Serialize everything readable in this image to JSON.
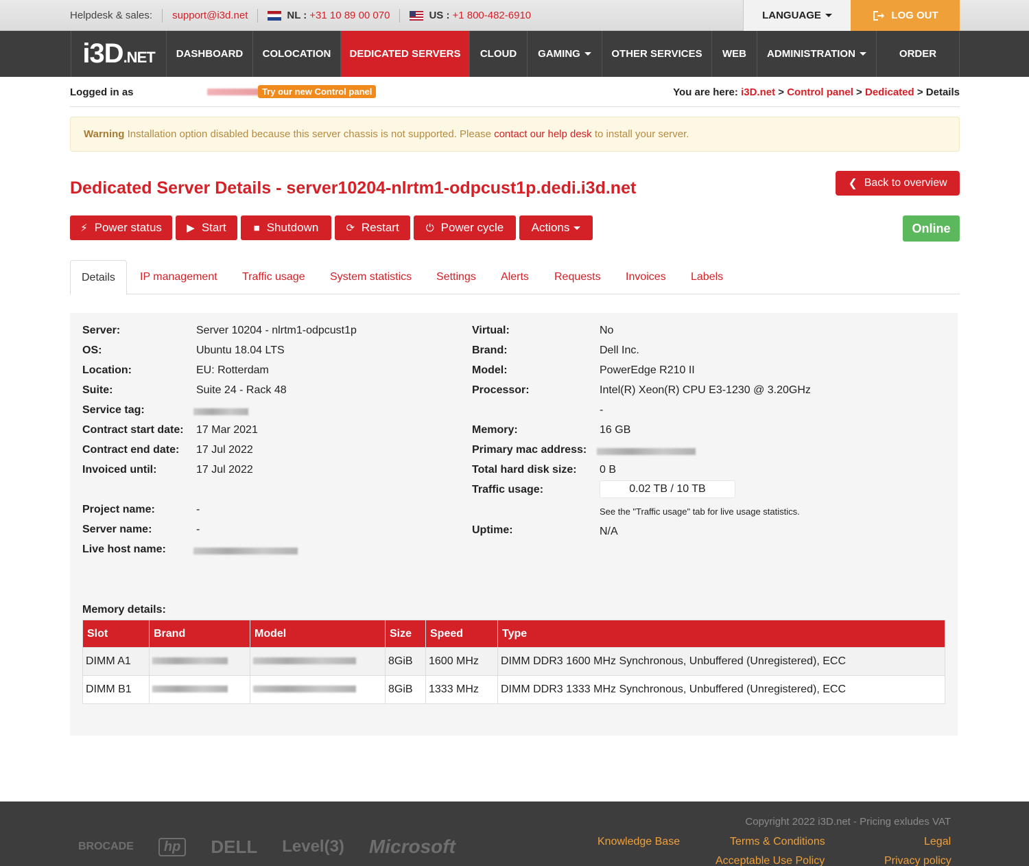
{
  "topbar": {
    "helpdesk_label": "Helpdesk & sales:",
    "email": "support@i3d.net",
    "nl_label": "NL :",
    "nl_phone": "+31 10 89 00 070",
    "us_label": "US :",
    "us_phone": "+1 800-482-6910",
    "language": "LANGUAGE",
    "logout": "LOG OUT"
  },
  "nav": {
    "logo_main": "i3D",
    "logo_suffix": ".NET",
    "items": [
      "DASHBOARD",
      "COLOCATION",
      "DEDICATED SERVERS",
      "CLOUD",
      "GAMING",
      "OTHER SERVICES",
      "WEB",
      "ADMINISTRATION",
      "ORDER"
    ]
  },
  "subheader": {
    "logged_in": "Logged in as",
    "try_new": "Try our new Control panel",
    "you_are_here": "You are here:",
    "crumb_1": "i3D.net",
    "crumb_2": "Control panel",
    "crumb_3": "Dedicated",
    "crumb_4": "Details"
  },
  "warning": {
    "title": "Warning",
    "text_1": "Installation option disabled because this server chassis is not supported. Please",
    "link": "contact our help desk",
    "text_2": "to install your server."
  },
  "page_title": "Dedicated Server Details - server10204-nlrtm1-odpcust1p.dedi.i3d.net",
  "back_button": "Back to overview",
  "actions": [
    "Power status",
    "Start",
    "Shutdown",
    "Restart",
    "Power cycle",
    "Actions"
  ],
  "status_badge": "Online",
  "tabs": [
    "Details",
    "IP management",
    "Traffic usage",
    "System statistics",
    "Settings",
    "Alerts",
    "Requests",
    "Invoices",
    "Labels"
  ],
  "details_left": [
    {
      "label": "Server:",
      "value": "Server 10204 - nlrtm1-odpcust1p"
    },
    {
      "label": "OS:",
      "value": "Ubuntu 18.04 LTS"
    },
    {
      "label": "Location:",
      "value": "EU: Rotterdam"
    },
    {
      "label": "Suite:",
      "value": "Suite 24 - Rack 48"
    },
    {
      "label": "Service tag:",
      "value": ""
    },
    {
      "label": "Contract start date:",
      "value": "17 Mar 2021"
    },
    {
      "label": "Contract end date:",
      "value": "17 Jul 2022"
    },
    {
      "label": "Invoiced until:",
      "value": "17 Jul 2022"
    },
    {
      "label": "Project name:",
      "value": "-"
    },
    {
      "label": "Server name:",
      "value": "-"
    },
    {
      "label": "Live host name:",
      "value": ""
    }
  ],
  "details_right": [
    {
      "label": "Virtual:",
      "value": "No"
    },
    {
      "label": "Brand:",
      "value": "Dell Inc."
    },
    {
      "label": "Model:",
      "value": "PowerEdge R210 II"
    },
    {
      "label": "Processor:",
      "value": "Intel(R) Xeon(R) CPU E3-1230 @ 3.20GHz"
    },
    {
      "label": "",
      "value": "-"
    },
    {
      "label": "Memory:",
      "value": "16 GB"
    },
    {
      "label": "Primary mac address:",
      "value": ""
    },
    {
      "label": "Total hard disk size:",
      "value": "0 B"
    },
    {
      "label": "Traffic usage:",
      "value": "0.02 TB / 10 TB"
    },
    {
      "label": "Uptime:",
      "value": "N/A"
    }
  ],
  "traffic_note": "See the \"Traffic usage\" tab for live usage statistics.",
  "memory": {
    "title": "Memory details:",
    "columns": [
      "Slot",
      "Brand",
      "Model",
      "Size",
      "Speed",
      "Type"
    ],
    "rows": [
      {
        "slot": "DIMM A1",
        "size": "8GiB",
        "speed": "1600 MHz",
        "type": "DIMM DDR3 1600 MHz Synchronous, Unbuffered (Unregistered), ECC"
      },
      {
        "slot": "DIMM B1",
        "size": "8GiB",
        "speed": "1333 MHz",
        "type": "DIMM DDR3 1333 MHz Synchronous, Unbuffered (Unregistered), ECC"
      }
    ]
  },
  "footer": {
    "brands": [
      "BROCADE",
      "hp",
      "DELL",
      "Level(3)",
      "Microsoft"
    ],
    "copyright": "Copyright 2022 i3D.net - Pricing exludes VAT",
    "links": [
      "Knowledge Base",
      "Terms & Conditions",
      "Legal",
      "Acceptable Use Policy",
      "Privacy policy"
    ]
  },
  "colors": {
    "brand_red": "#d42027",
    "orange": "#f0a039",
    "online_green": "#5cb85c",
    "nav_dark": "#3d3d3d"
  }
}
